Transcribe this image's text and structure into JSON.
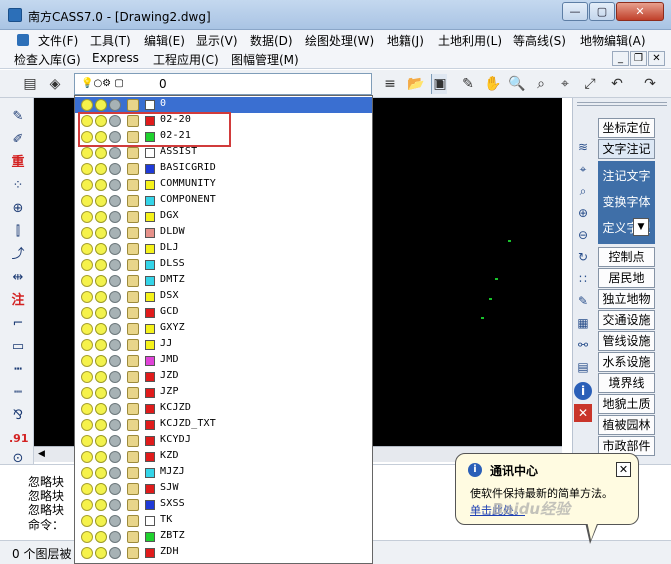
{
  "window": {
    "title": "南方CASS7.0 - [Drawing2.dwg]",
    "min": "—",
    "max": "▢",
    "close": "✕"
  },
  "menu_row1": [
    "文件(F)",
    "工具(T)",
    "编辑(E)",
    "显示(V)",
    "数据(D)",
    "绘图处理(W)",
    "地籍(J)",
    "土地利用(L)",
    "等高线(S)",
    "地物编辑(A)"
  ],
  "menu_row2": [
    "检查入库(G)",
    "Express",
    "工程应用(C)",
    "图幅管理(M)"
  ],
  "toolbar": {
    "layer_value": "0"
  },
  "layers": [
    {
      "name": "0",
      "color": "#ffffff",
      "selected": true
    },
    {
      "name": "02-20",
      "color": "#e01b1b"
    },
    {
      "name": "02-21",
      "color": "#1fd12e"
    },
    {
      "name": "ASSIST",
      "color": "#ffffff"
    },
    {
      "name": "BASICGRID",
      "color": "#1f3ad8"
    },
    {
      "name": "COMMUNITY",
      "color": "#f5f21a"
    },
    {
      "name": "COMPONENT",
      "color": "#34d4e8"
    },
    {
      "name": "DGX",
      "color": "#f5f21a"
    },
    {
      "name": "DLDW",
      "color": "#e6918a"
    },
    {
      "name": "DLJ",
      "color": "#f5f21a"
    },
    {
      "name": "DLSS",
      "color": "#34d4e8"
    },
    {
      "name": "DMTZ",
      "color": "#34d4e8"
    },
    {
      "name": "DSX",
      "color": "#f5f21a"
    },
    {
      "name": "GCD",
      "color": "#e01b1b"
    },
    {
      "name": "GXYZ",
      "color": "#f5f21a"
    },
    {
      "name": "JJ",
      "color": "#f5f21a"
    },
    {
      "name": "JMD",
      "color": "#e043d8"
    },
    {
      "name": "JZD",
      "color": "#e01b1b"
    },
    {
      "name": "JZP",
      "color": "#e01b1b"
    },
    {
      "name": "KCJZD",
      "color": "#e01b1b"
    },
    {
      "name": "KCJZD_TXT",
      "color": "#e01b1b"
    },
    {
      "name": "KCYDJ",
      "color": "#e01b1b"
    },
    {
      "name": "KZD",
      "color": "#e01b1b"
    },
    {
      "name": "MJZJ",
      "color": "#34d4e8"
    },
    {
      "name": "SJW",
      "color": "#e01b1b"
    },
    {
      "name": "SXSS",
      "color": "#1f3ad8"
    },
    {
      "name": "TK",
      "color": "#ffffff"
    },
    {
      "name": "ZBTZ",
      "color": "#1fd12e"
    },
    {
      "name": "ZDH",
      "color": "#e01b1b"
    }
  ],
  "right_panel": {
    "buttons_top": [
      "坐标定位",
      "文字注记"
    ],
    "blue_items": [
      "注记文字",
      "变换字体",
      "定义字型"
    ],
    "buttons_bottom": [
      "控制点",
      "居民地",
      "独立地物",
      "交通设施",
      "管线设施",
      "水系设施",
      "境界线",
      "地貌土质",
      "植被园林",
      "市政部件"
    ]
  },
  "command": {
    "lines": [
      "忽略块",
      "忽略块",
      "忽略块"
    ],
    "prompt": "命令："
  },
  "status": {
    "text": "0 个图层被"
  },
  "notification": {
    "title": "通讯中心",
    "message": "使软件保持最新的简单方法。",
    "link": "单击此处。"
  },
  "watermark": "Baidu经验"
}
